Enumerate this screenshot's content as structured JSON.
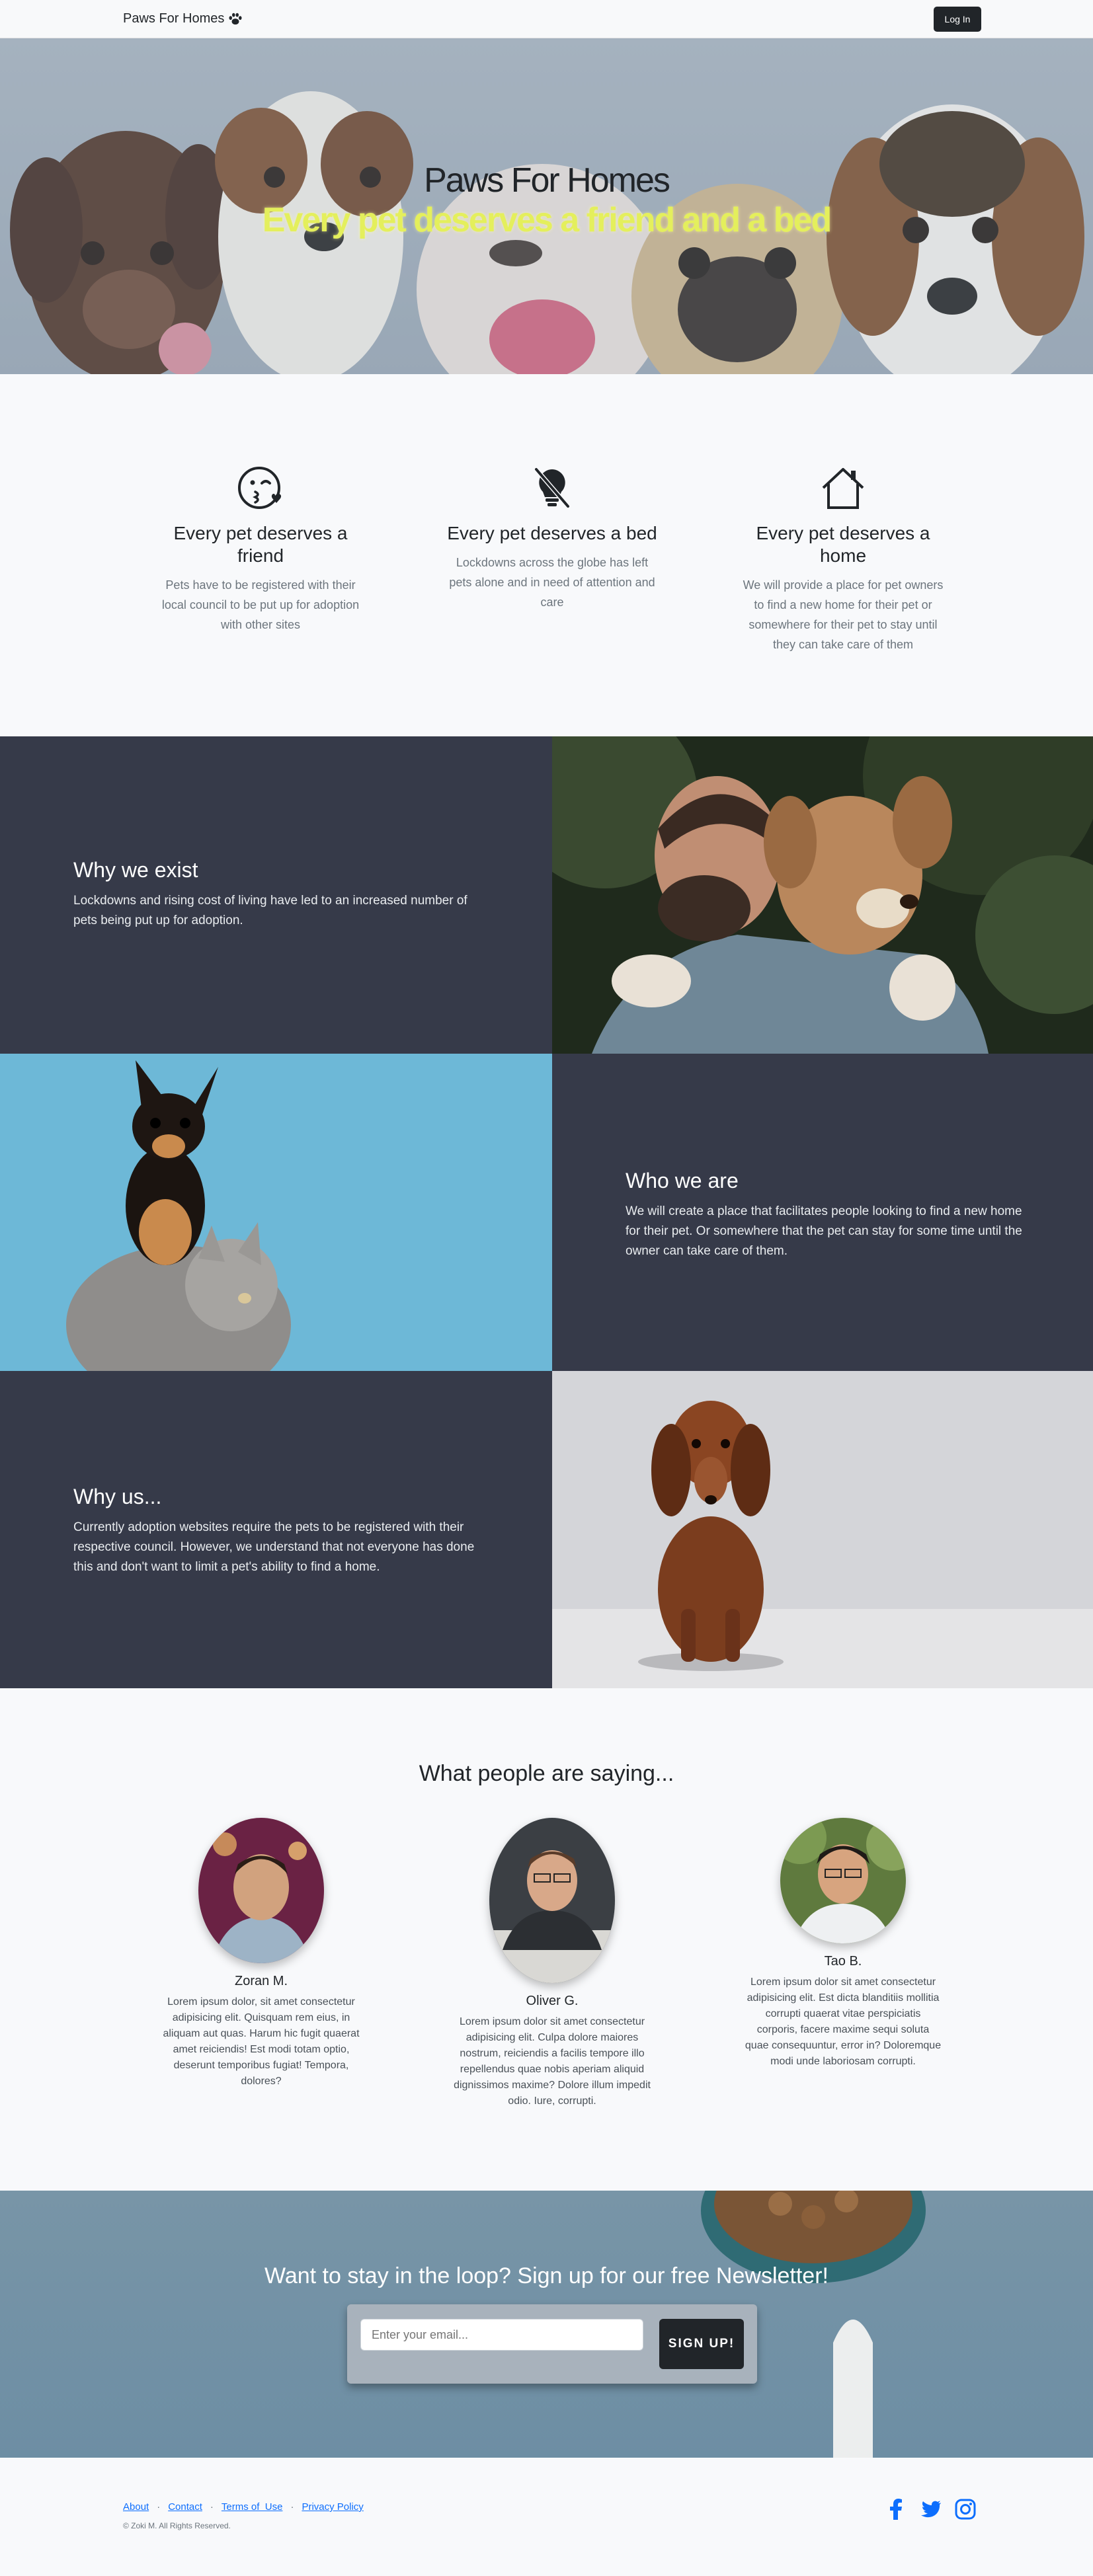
{
  "nav": {
    "brand": "Paws For Homes",
    "login_label": "Log In"
  },
  "hero": {
    "title": "Paws For Homes",
    "subtitle": "Every pet deserves a friend and a bed"
  },
  "features": [
    {
      "icon": "emoji-kiss-heart-icon",
      "title": "Every pet deserves a friend",
      "text": "Pets have to be registered with their local council to be put up for adoption with other sites"
    },
    {
      "icon": "lightbulb-off-icon",
      "title": "Every pet deserves a bed",
      "text": "Lockdowns across the globe has left pets alone and in need of attention and care"
    },
    {
      "icon": "house-icon",
      "title": "Every pet deserves a home",
      "text": "We will provide a place for pet owners to find a new home for their pet or somewhere for their pet to stay until they can take care of them"
    }
  ],
  "showcase": [
    {
      "title": "Why we exist",
      "text": "Lockdowns and rising cost of living have led to an increased number of pets being put up for adoption."
    },
    {
      "title": "Who we are",
      "text": "We will create a place that facilitates people looking to find a new home for their pet. Or somewhere that the pet can stay for some time until the owner can take care of them."
    },
    {
      "title": "Why us...",
      "text": "Currently adoption websites require the pets to be registered with their respective council. However, we understand that not everyone has done this and don't want to limit a pet's ability to find a home."
    }
  ],
  "testimonials": {
    "heading": "What people are saying...",
    "items": [
      {
        "name": "Zoran M.",
        "quote": "Lorem ipsum dolor, sit amet consectetur adipisicing elit. Quisquam rem eius, in aliquam aut quas. Harum hic fugit quaerat amet reiciendis! Est modi totam optio, deserunt temporibus fugiat! Tempora, dolores?"
      },
      {
        "name": "Oliver G.",
        "quote": "Lorem ipsum dolor sit amet consectetur adipisicing elit. Culpa dolore maiores nostrum, reiciendis a facilis tempore illo repellendus quae nobis aperiam aliquid dignissimos maxime? Dolore illum impedit odio. Iure, corrupti."
      },
      {
        "name": "Tao B.",
        "quote": "Lorem ipsum dolor sit amet consectetur adipisicing elit. Est dicta blanditiis mollitia corrupti quaerat vitae perspiciatis corporis, facere maxime sequi soluta quae consequuntur, error in? Doloremque modi unde laboriosam corrupti."
      }
    ]
  },
  "newsletter": {
    "heading": "Want to stay in the loop? Sign up for our free Newsletter!",
    "placeholder": "Enter your email...",
    "button_label": "SIGN UP!"
  },
  "footer": {
    "links": [
      "About",
      "Contact",
      "Terms of  Use",
      "Privacy Policy"
    ],
    "separator": "·",
    "copyright": "© Zoki M. All Rights Reserved.",
    "socials": [
      "facebook-icon",
      "twitter-icon",
      "instagram-icon"
    ]
  },
  "colors": {
    "dark_panel": "#363a49",
    "hero_subtitle": "#e4ef5c",
    "link": "#0d6efd",
    "social": "#0d6efd"
  }
}
